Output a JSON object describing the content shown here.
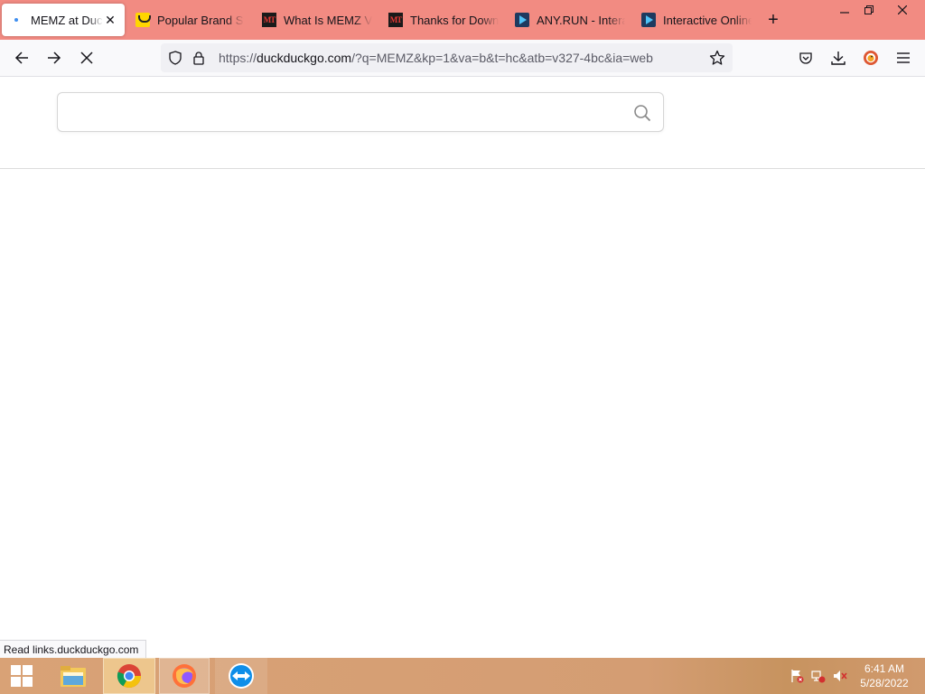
{
  "browser": {
    "tabs": [
      {
        "label": "MEMZ at DuckDuckGo",
        "icon": "loading-dot-icon",
        "active": true
      },
      {
        "label": "Popular Brand Stores",
        "icon": "smiley-favicon-icon",
        "active": false
      },
      {
        "label": "What Is MEMZ Virus",
        "icon": "mt-favicon-icon",
        "active": false
      },
      {
        "label": "Thanks for Downloading",
        "icon": "mt-favicon-icon",
        "active": false
      },
      {
        "label": "ANY.RUN - Interactive",
        "icon": "anyrun-favicon-icon",
        "active": false
      },
      {
        "label": "Interactive Online",
        "icon": "anyrun-favicon-icon",
        "active": false
      }
    ],
    "new_tab_glyph": "+",
    "close_glyph": "✕",
    "url": {
      "scheme": "https://",
      "host": "duckduckgo.com",
      "rest": "/?q=MEMZ&kp=1&va=b&t=hc&atb=v327-4bc&ia=web"
    },
    "status_text": "Read links.duckduckgo.com"
  },
  "page": {
    "search_value": "",
    "search_placeholder": ""
  },
  "taskbar": {
    "time": "6:41 AM",
    "date": "5/28/2022"
  },
  "colors": {
    "tabstrip": "#f28b82",
    "taskbar": "#d9a276"
  }
}
